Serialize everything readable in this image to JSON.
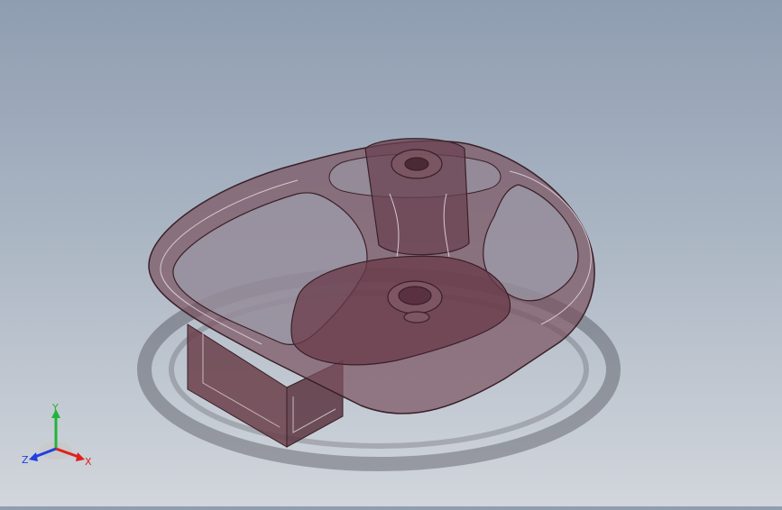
{
  "viewport": {
    "background_top": "#8f9db1",
    "background_bottom": "#d2d6dc",
    "model_color": "#6e4b57",
    "edge_color": "#3a2028"
  },
  "triad": {
    "x_label": "X",
    "y_label": "Y",
    "z_label": "Z",
    "x_color": "#e0201c",
    "y_color": "#22b43a",
    "z_color": "#2040e0"
  }
}
